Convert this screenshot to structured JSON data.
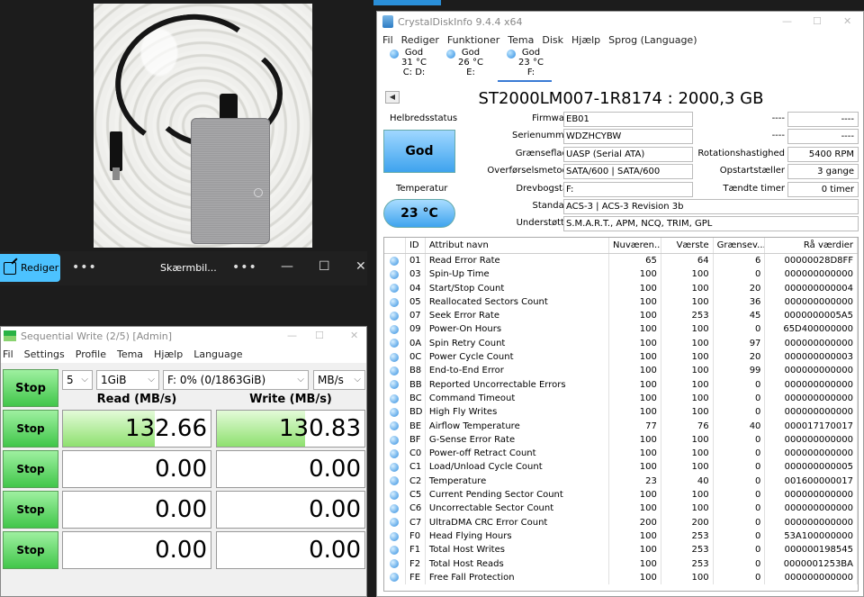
{
  "photos": {
    "edit_label": "Rediger",
    "more_label": "•••",
    "title": "Skærmbil...",
    "more2_label": "•••",
    "minimize": "—",
    "maximize": "☐",
    "close": "✕"
  },
  "cdm": {
    "title": "Sequential Write (2/5) [Admin]",
    "min": "—",
    "max": "☐",
    "close": "✕",
    "menu": [
      "Fil",
      "Settings",
      "Profile",
      "Tema",
      "Hjælp",
      "Language"
    ],
    "count": "5",
    "size": "1GiB",
    "drive": "F: 0% (0/1863GiB)",
    "unit": "MB/s",
    "main_stop": "Stop",
    "read_header": "Read (MB/s)",
    "write_header": "Write (MB/s)",
    "rows": [
      {
        "stop": "Stop",
        "read": "132.66",
        "write": "130.83",
        "read_fill": 0.62,
        "write_fill": 0.6
      },
      {
        "stop": "Stop",
        "read": "0.00",
        "write": "0.00",
        "read_fill": 0,
        "write_fill": 0
      },
      {
        "stop": "Stop",
        "read": "0.00",
        "write": "0.00",
        "read_fill": 0,
        "write_fill": 0
      },
      {
        "stop": "Stop",
        "read": "0.00",
        "write": "0.00",
        "read_fill": 0,
        "write_fill": 0
      }
    ]
  },
  "cdi": {
    "title": "CrystalDiskInfo 9.4.4 x64",
    "min": "—",
    "max": "☐",
    "close": "✕",
    "menu": [
      "Fil",
      "Rediger",
      "Funktioner",
      "Tema",
      "Disk",
      "Hjælp",
      "Sprog (Language)"
    ],
    "disks": [
      {
        "status": "God",
        "temp": "31 °C",
        "drive": "C: D:"
      },
      {
        "status": "God",
        "temp": "26 °C",
        "drive": "E:"
      },
      {
        "status": "God",
        "temp": "23 °C",
        "drive": "F:"
      }
    ],
    "back": "◀",
    "disk_title": "ST2000LM007-1R8174 : 2000,3 GB",
    "health_label": "Helbredsstatus",
    "health_value": "God",
    "temp_label": "Temperatur",
    "temp_value": "23 °C",
    "firmware_label": "Firmware",
    "firmware": "EB01",
    "serial_label": "Serienummer",
    "serial": "WDZHCYBW",
    "interface_label": "Grænseflade",
    "interface": "UASP (Serial ATA)",
    "transfer_label": "Overførselsmetode",
    "transfer": "SATA/600 | SATA/600",
    "letter_label": "Drevbogstav",
    "letter": "F:",
    "standard_label": "Standard",
    "standard": "ACS-3 | ACS-3 Revision 3b",
    "supported_label": "Understøttet",
    "supported": "S.M.A.R.T., APM, NCQ, TRIM, GPL",
    "r1_label": "----",
    "r1_value": "----",
    "r2_label": "----",
    "r2_value": "----",
    "rpm_label": "Rotationshastighed",
    "rpm": "5400 RPM",
    "count_label": "Opstartstæller",
    "count": "3 gange",
    "hours_label": "Tændte timer",
    "hours": "0 timer",
    "attr_headers": [
      "ID",
      "Attribut navn",
      "Nuværen...",
      "Værste",
      "Grænsev...",
      "Rå værdier"
    ],
    "attributes": [
      {
        "id": "01",
        "name": "Read Error Rate",
        "cur": "65",
        "worst": "64",
        "thr": "6",
        "raw": "00000028D8FF"
      },
      {
        "id": "03",
        "name": "Spin-Up Time",
        "cur": "100",
        "worst": "100",
        "thr": "0",
        "raw": "000000000000"
      },
      {
        "id": "04",
        "name": "Start/Stop Count",
        "cur": "100",
        "worst": "100",
        "thr": "20",
        "raw": "000000000004"
      },
      {
        "id": "05",
        "name": "Reallocated Sectors Count",
        "cur": "100",
        "worst": "100",
        "thr": "36",
        "raw": "000000000000"
      },
      {
        "id": "07",
        "name": "Seek Error Rate",
        "cur": "100",
        "worst": "253",
        "thr": "45",
        "raw": "0000000005A5"
      },
      {
        "id": "09",
        "name": "Power-On Hours",
        "cur": "100",
        "worst": "100",
        "thr": "0",
        "raw": "65D400000000"
      },
      {
        "id": "0A",
        "name": "Spin Retry Count",
        "cur": "100",
        "worst": "100",
        "thr": "97",
        "raw": "000000000000"
      },
      {
        "id": "0C",
        "name": "Power Cycle Count",
        "cur": "100",
        "worst": "100",
        "thr": "20",
        "raw": "000000000003"
      },
      {
        "id": "B8",
        "name": "End-to-End Error",
        "cur": "100",
        "worst": "100",
        "thr": "99",
        "raw": "000000000000"
      },
      {
        "id": "BB",
        "name": "Reported Uncorrectable Errors",
        "cur": "100",
        "worst": "100",
        "thr": "0",
        "raw": "000000000000"
      },
      {
        "id": "BC",
        "name": "Command Timeout",
        "cur": "100",
        "worst": "100",
        "thr": "0",
        "raw": "000000000000"
      },
      {
        "id": "BD",
        "name": "High Fly Writes",
        "cur": "100",
        "worst": "100",
        "thr": "0",
        "raw": "000000000000"
      },
      {
        "id": "BE",
        "name": "Airflow Temperature",
        "cur": "77",
        "worst": "76",
        "thr": "40",
        "raw": "000017170017"
      },
      {
        "id": "BF",
        "name": "G-Sense Error Rate",
        "cur": "100",
        "worst": "100",
        "thr": "0",
        "raw": "000000000000"
      },
      {
        "id": "C0",
        "name": "Power-off Retract Count",
        "cur": "100",
        "worst": "100",
        "thr": "0",
        "raw": "000000000000"
      },
      {
        "id": "C1",
        "name": "Load/Unload Cycle Count",
        "cur": "100",
        "worst": "100",
        "thr": "0",
        "raw": "000000000005"
      },
      {
        "id": "C2",
        "name": "Temperature",
        "cur": "23",
        "worst": "40",
        "thr": "0",
        "raw": "001600000017"
      },
      {
        "id": "C5",
        "name": "Current Pending Sector Count",
        "cur": "100",
        "worst": "100",
        "thr": "0",
        "raw": "000000000000"
      },
      {
        "id": "C6",
        "name": "Uncorrectable Sector Count",
        "cur": "100",
        "worst": "100",
        "thr": "0",
        "raw": "000000000000"
      },
      {
        "id": "C7",
        "name": "UltraDMA CRC Error Count",
        "cur": "200",
        "worst": "200",
        "thr": "0",
        "raw": "000000000000"
      },
      {
        "id": "F0",
        "name": "Head Flying Hours",
        "cur": "100",
        "worst": "253",
        "thr": "0",
        "raw": "53A100000000"
      },
      {
        "id": "F1",
        "name": "Total Host Writes",
        "cur": "100",
        "worst": "253",
        "thr": "0",
        "raw": "000000198545"
      },
      {
        "id": "F2",
        "name": "Total Host Reads",
        "cur": "100",
        "worst": "253",
        "thr": "0",
        "raw": "0000001253BA"
      },
      {
        "id": "FE",
        "name": "Free Fall Protection",
        "cur": "100",
        "worst": "100",
        "thr": "0",
        "raw": "000000000000"
      }
    ]
  }
}
